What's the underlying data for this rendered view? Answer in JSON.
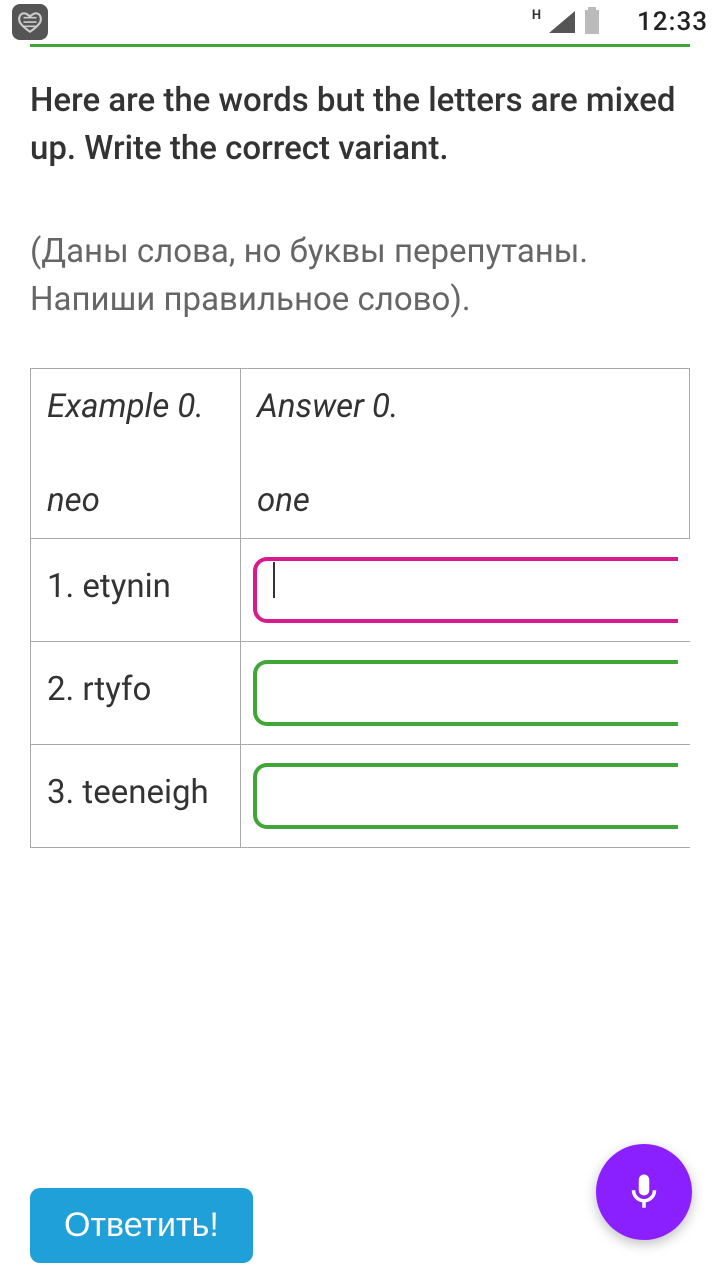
{
  "status": {
    "network_label": "H",
    "time": "12:33"
  },
  "instruction_en": "Here are the words but the letters are mixed up. Write the correct variant.",
  "instruction_ru": "(Даны слова, но буквы перепутаны. Напиши правильное слово).",
  "example": {
    "label": "Example 0.",
    "word": "neo",
    "answer_label": "Answer 0.",
    "answer": "one"
  },
  "rows": [
    {
      "prompt": "1. etynin",
      "value": "",
      "active": true
    },
    {
      "prompt": "2. rtyfo",
      "value": "",
      "active": false
    },
    {
      "prompt": "3. teeneigh",
      "value": "",
      "active": false
    }
  ],
  "submit_label": "Ответить!"
}
